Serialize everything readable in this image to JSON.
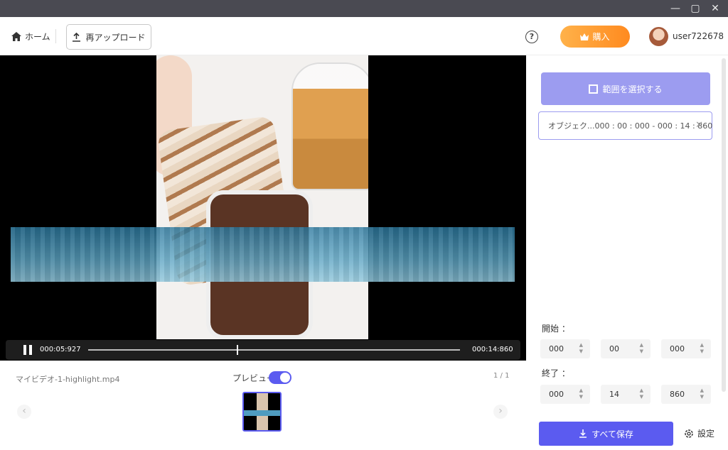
{
  "window": {
    "controls": {
      "minimize": "—",
      "maximize": "▢",
      "close": "✕"
    }
  },
  "header": {
    "home_label": "ホーム",
    "reupload_label": "再アップロード",
    "help_icon": "?",
    "buy_label": "購入",
    "username": "user722678"
  },
  "player": {
    "current_time": "000:05:927",
    "end_time": "000:14:860",
    "progress_fraction": 0.4
  },
  "strip": {
    "filename": "マイビデオ-1-highlight.mp4",
    "preview_label": "プレビュー",
    "preview_enabled": true,
    "pager": "1 / 1",
    "prev_arrow": "‹",
    "next_arrow": "›"
  },
  "panel": {
    "select_range_label": "範囲を選択する",
    "object_item": "オブジェク...000 : 00 : 000 - 000 : 14 : 860",
    "object_close": "✕",
    "start_label": "開始 ：",
    "start": [
      "000",
      "00",
      "000"
    ],
    "end_label": "終了 ：",
    "end": [
      "000",
      "14",
      "860"
    ],
    "save_all_label": "すべて保存",
    "settings_label": "設定"
  },
  "colors": {
    "accent": "#5b5bf0",
    "accent_light": "#9c9cf0",
    "buy_orange": "#ff9a2e"
  }
}
